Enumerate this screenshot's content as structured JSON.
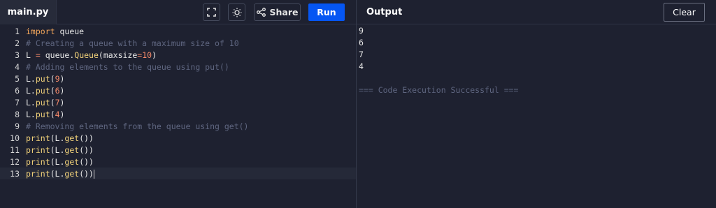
{
  "editor": {
    "file_tab": "main.py",
    "toolbar": {
      "fullscreen_icon": "fullscreen-icon",
      "theme_icon": "sun-icon",
      "share_label": "Share",
      "share_icon": "share-icon",
      "run_label": "Run"
    },
    "line_numbers": [
      "1",
      "2",
      "3",
      "4",
      "5",
      "6",
      "7",
      "8",
      "9",
      "10",
      "11",
      "12",
      "13"
    ],
    "lines": [
      "import queue",
      "# Creating a queue with a maximum size of 10",
      "L = queue.Queue(maxsize=10)",
      "# Adding elements to the queue using put()",
      "L.put(9)",
      "L.put(6)",
      "L.put(7)",
      "L.put(4)",
      "# Removing elements from the queue using get()",
      "print(L.get())",
      "print(L.get())",
      "print(L.get())",
      "print(L.get())"
    ],
    "active_line": 13
  },
  "output": {
    "title": "Output",
    "clear_label": "Clear",
    "lines": [
      "9",
      "6",
      "7",
      "4",
      "",
      "=== Code Execution Successful ==="
    ]
  },
  "colors": {
    "background": "#1e2130",
    "run_button": "#0556f3",
    "comment": "#5f6680",
    "keyword": "#f2a55a",
    "number": "#f58a6a",
    "function": "#f2d27a"
  }
}
